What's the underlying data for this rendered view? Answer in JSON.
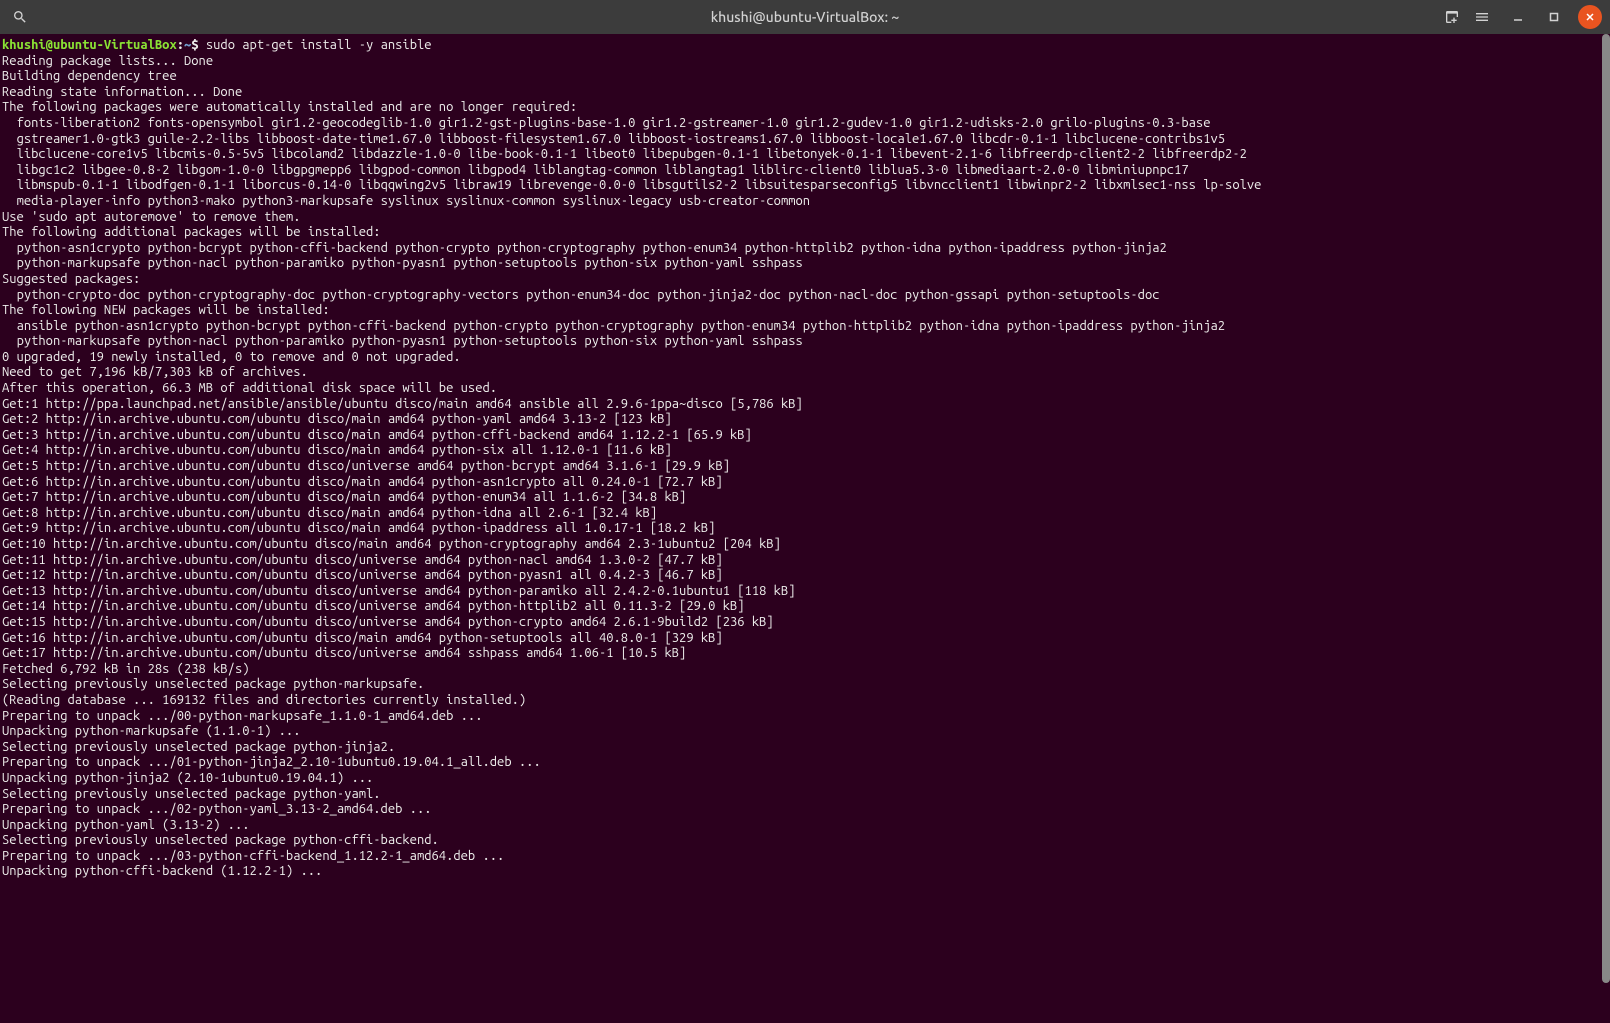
{
  "window": {
    "title": "khushi@ubuntu-VirtualBox: ~"
  },
  "prompt": {
    "userhost": "khushi@ubuntu-VirtualBox",
    "sep1": ":",
    "path": "~",
    "dollar": "$ ",
    "command": "sudo apt-get install -y ansible"
  },
  "lines": [
    "Reading package lists... Done",
    "Building dependency tree",
    "Reading state information... Done",
    "The following packages were automatically installed and are no longer required:",
    "  fonts-liberation2 fonts-opensymbol gir1.2-geocodeglib-1.0 gir1.2-gst-plugins-base-1.0 gir1.2-gstreamer-1.0 gir1.2-gudev-1.0 gir1.2-udisks-2.0 grilo-plugins-0.3-base",
    "  gstreamer1.0-gtk3 guile-2.2-libs libboost-date-time1.67.0 libboost-filesystem1.67.0 libboost-iostreams1.67.0 libboost-locale1.67.0 libcdr-0.1-1 libclucene-contribs1v5",
    "  libclucene-core1v5 libcmis-0.5-5v5 libcolamd2 libdazzle-1.0-0 libe-book-0.1-1 libeot0 libepubgen-0.1-1 libetonyek-0.1-1 libevent-2.1-6 libfreerdp-client2-2 libfreerdp2-2",
    "  libgc1c2 libgee-0.8-2 libgom-1.0-0 libgpgmepp6 libgpod-common libgpod4 liblangtag-common liblangtag1 liblirc-client0 liblua5.3-0 libmediaart-2.0-0 libminiupnpc17",
    "  libmspub-0.1-1 libodfgen-0.1-1 liborcus-0.14-0 libqqwing2v5 libraw19 librevenge-0.0-0 libsgutils2-2 libsuitesparseconfig5 libvncclient1 libwinpr2-2 libxmlsec1-nss lp-solve",
    "  media-player-info python3-mako python3-markupsafe syslinux syslinux-common syslinux-legacy usb-creator-common",
    "Use 'sudo apt autoremove' to remove them.",
    "The following additional packages will be installed:",
    "  python-asn1crypto python-bcrypt python-cffi-backend python-crypto python-cryptography python-enum34 python-httplib2 python-idna python-ipaddress python-jinja2",
    "  python-markupsafe python-nacl python-paramiko python-pyasn1 python-setuptools python-six python-yaml sshpass",
    "Suggested packages:",
    "  python-crypto-doc python-cryptography-doc python-cryptography-vectors python-enum34-doc python-jinja2-doc python-nacl-doc python-gssapi python-setuptools-doc",
    "The following NEW packages will be installed:",
    "  ansible python-asn1crypto python-bcrypt python-cffi-backend python-crypto python-cryptography python-enum34 python-httplib2 python-idna python-ipaddress python-jinja2",
    "  python-markupsafe python-nacl python-paramiko python-pyasn1 python-setuptools python-six python-yaml sshpass",
    "0 upgraded, 19 newly installed, 0 to remove and 0 not upgraded.",
    "Need to get 7,196 kB/7,303 kB of archives.",
    "After this operation, 66.3 MB of additional disk space will be used.",
    "Get:1 http://ppa.launchpad.net/ansible/ansible/ubuntu disco/main amd64 ansible all 2.9.6-1ppa~disco [5,786 kB]",
    "Get:2 http://in.archive.ubuntu.com/ubuntu disco/main amd64 python-yaml amd64 3.13-2 [123 kB]",
    "Get:3 http://in.archive.ubuntu.com/ubuntu disco/main amd64 python-cffi-backend amd64 1.12.2-1 [65.9 kB]",
    "Get:4 http://in.archive.ubuntu.com/ubuntu disco/main amd64 python-six all 1.12.0-1 [11.6 kB]",
    "Get:5 http://in.archive.ubuntu.com/ubuntu disco/universe amd64 python-bcrypt amd64 3.1.6-1 [29.9 kB]",
    "Get:6 http://in.archive.ubuntu.com/ubuntu disco/main amd64 python-asn1crypto all 0.24.0-1 [72.7 kB]",
    "Get:7 http://in.archive.ubuntu.com/ubuntu disco/main amd64 python-enum34 all 1.1.6-2 [34.8 kB]",
    "Get:8 http://in.archive.ubuntu.com/ubuntu disco/main amd64 python-idna all 2.6-1 [32.4 kB]",
    "Get:9 http://in.archive.ubuntu.com/ubuntu disco/main amd64 python-ipaddress all 1.0.17-1 [18.2 kB]",
    "Get:10 http://in.archive.ubuntu.com/ubuntu disco/main amd64 python-cryptography amd64 2.3-1ubuntu2 [204 kB]",
    "Get:11 http://in.archive.ubuntu.com/ubuntu disco/universe amd64 python-nacl amd64 1.3.0-2 [47.7 kB]",
    "Get:12 http://in.archive.ubuntu.com/ubuntu disco/universe amd64 python-pyasn1 all 0.4.2-3 [46.7 kB]",
    "Get:13 http://in.archive.ubuntu.com/ubuntu disco/universe amd64 python-paramiko all 2.4.2-0.1ubuntu1 [118 kB]",
    "Get:14 http://in.archive.ubuntu.com/ubuntu disco/universe amd64 python-httplib2 all 0.11.3-2 [29.0 kB]",
    "Get:15 http://in.archive.ubuntu.com/ubuntu disco/universe amd64 python-crypto amd64 2.6.1-9build2 [236 kB]",
    "Get:16 http://in.archive.ubuntu.com/ubuntu disco/main amd64 python-setuptools all 40.8.0-1 [329 kB]",
    "Get:17 http://in.archive.ubuntu.com/ubuntu disco/universe amd64 sshpass amd64 1.06-1 [10.5 kB]",
    "Fetched 6,792 kB in 28s (238 kB/s)",
    "Selecting previously unselected package python-markupsafe.",
    "(Reading database ... 169132 files and directories currently installed.)",
    "Preparing to unpack .../00-python-markupsafe_1.1.0-1_amd64.deb ...",
    "Unpacking python-markupsafe (1.1.0-1) ...",
    "Selecting previously unselected package python-jinja2.",
    "Preparing to unpack .../01-python-jinja2_2.10-1ubuntu0.19.04.1_all.deb ...",
    "Unpacking python-jinja2 (2.10-1ubuntu0.19.04.1) ...",
    "Selecting previously unselected package python-yaml.",
    "Preparing to unpack .../02-python-yaml_3.13-2_amd64.deb ...",
    "Unpacking python-yaml (3.13-2) ...",
    "Selecting previously unselected package python-cffi-backend.",
    "Preparing to unpack .../03-python-cffi-backend_1.12.2-1_amd64.deb ...",
    "Unpacking python-cffi-backend (1.12.2-1) ..."
  ]
}
